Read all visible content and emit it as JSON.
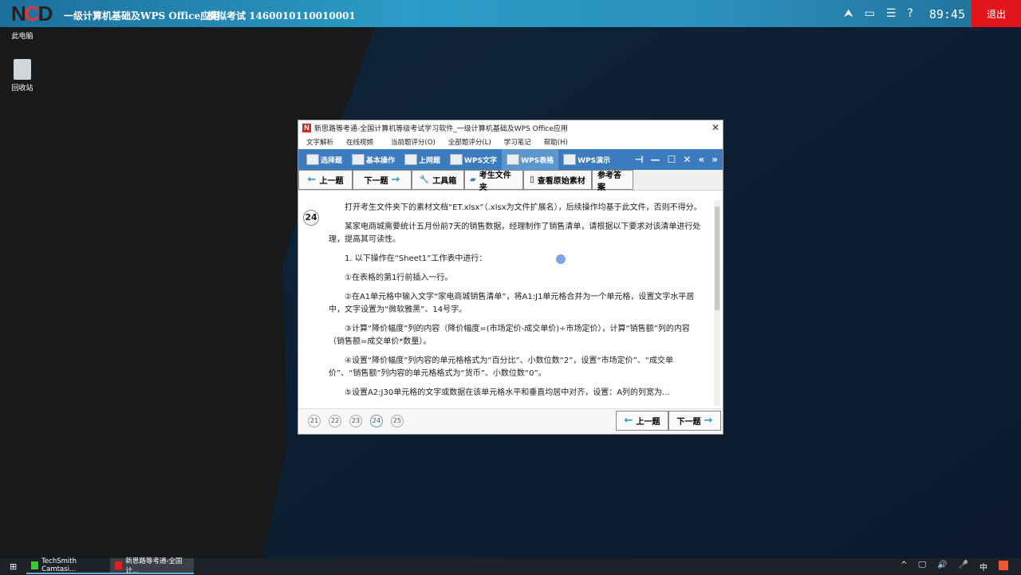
{
  "topbar": {
    "title": "一级计算机基础及WPS Office应用",
    "exam": "模拟考试 1460010110010001",
    "timer": "89:45",
    "exit": "退出",
    "icons": [
      "collapse-icon",
      "window-icon",
      "list-icon",
      "help-icon"
    ]
  },
  "desktop": [
    {
      "label": "此电脑"
    },
    {
      "label": "回收站"
    }
  ],
  "window": {
    "title": "新思路等考通-全国计算机等级考试学习软件_一级计算机基础及WPS Office应用",
    "menu": [
      "文字解析",
      "在线视频",
      "当前题评分(O)",
      "全部题评分(L)",
      "学习笔记",
      "帮助(H)"
    ],
    "tabs": [
      "选择题",
      "基本操作",
      "上网题",
      "WPS文字",
      "WPS表格",
      "WPS演示"
    ],
    "toolbar": {
      "prev": "上一题",
      "next": "下一题",
      "tools": "工具箱",
      "folder": "考生文件夹",
      "material": "查看原始素材",
      "answer": "参考答案"
    },
    "question_number": "24",
    "paragraphs": [
      "打开考生文件夹下的素材文档“ET.xlsx”（.xlsx为文件扩展名），后续操作均基于此文件，否则不得分。",
      "某家电商城需要统计五月份前7天的销售数据，经理制作了销售清单，请根据以下要求对该清单进行处理，提高其可读性。",
      "1. 以下操作在“Sheet1”工作表中进行：",
      "①在表格的第1行前插入一行。",
      "②在A1单元格中输入文字“家电商城销售清单”，将A1:J1单元格合并为一个单元格，设置文字水平居中，文字设置为“微软雅黑”、14号字。",
      "③计算“降价幅度”列的内容（降价幅度=(市场定价-成交单价)÷市场定价），计算“销售额”列的内容（销售额=成交单价*数量）。",
      "④设置“降价幅度”列内容的单元格格式为“百分比”、小数位数“2”，设置“市场定价”、“成交单价”、“销售额”列内容的单元格格式为“货币”、小数位数“0”。",
      "⑤设置A2:J30单元格的文字或数据在该单元格水平和垂直均居中对齐，设置：A列的列宽为..."
    ],
    "pages": [
      "21",
      "22",
      "23",
      "24",
      "25"
    ],
    "current_page": "24"
  },
  "taskbar": {
    "tasks": [
      "TechSmith Camtasi...",
      "新思路等考通-全国计..."
    ],
    "tray_ime": "中"
  }
}
